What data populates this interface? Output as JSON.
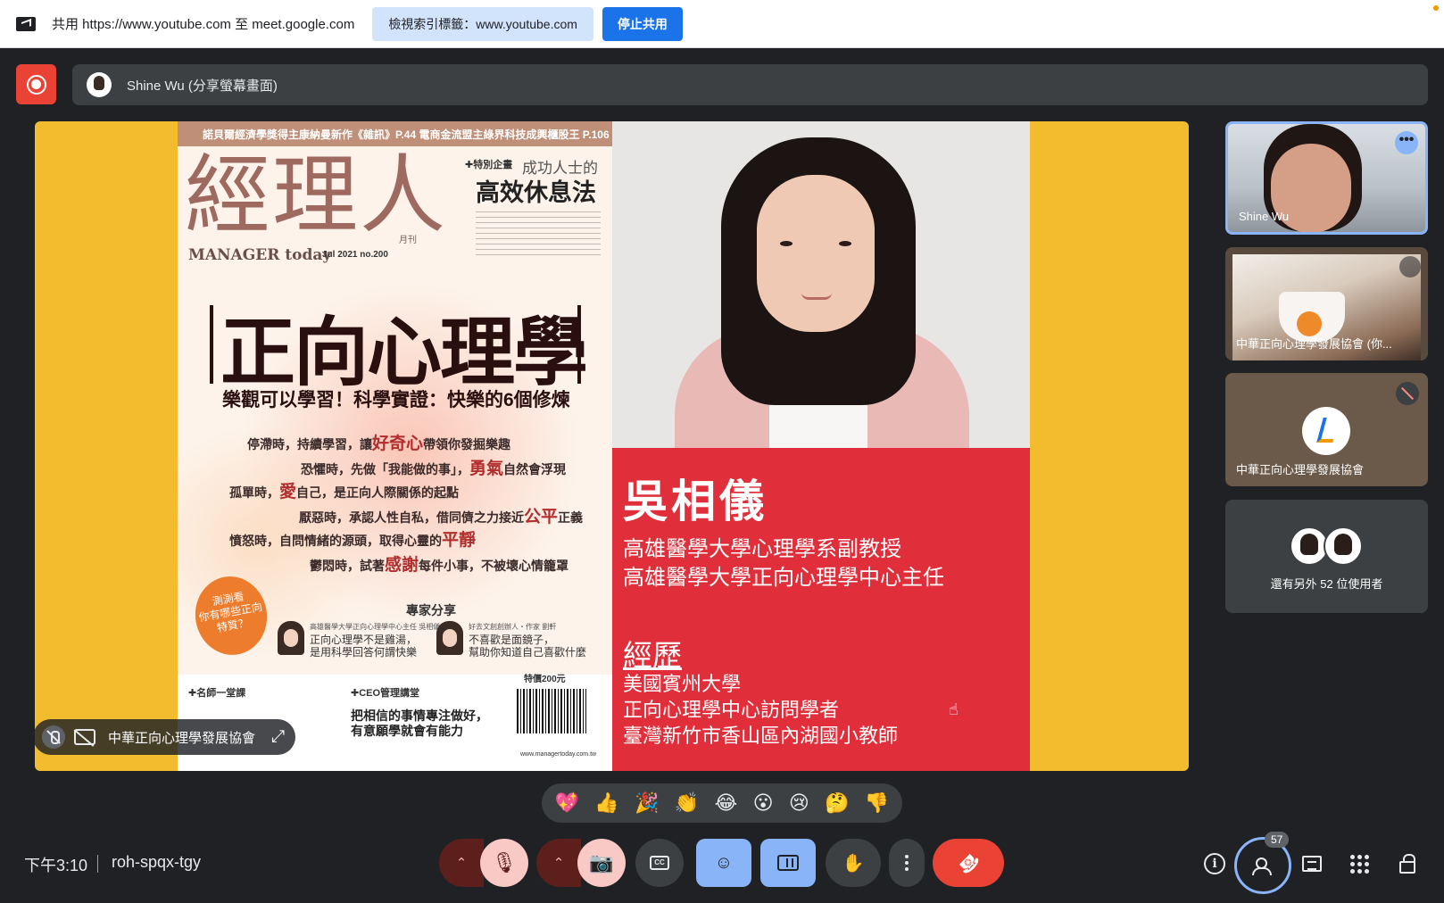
{
  "share_bar": {
    "sharing_text": "共用 https://www.youtube.com 至 meet.google.com",
    "view_tab_button": "檢視索引標籤：www.youtube.com",
    "stop_sharing_button": "停止共用"
  },
  "presenter_bar": {
    "name": "Shine Wu (分享螢幕畫面)"
  },
  "slide": {
    "magazine": {
      "top_strip": "諾貝爾經濟學獎得主康納曼新作《雜訊》P.44  電商金流盟主綠界科技成興櫃股王 P.106",
      "title": "經理人",
      "month": "月刊",
      "brand": "MANAGER today",
      "issue": "Jul 2021  no.200",
      "special_tag": "✚特別企畫",
      "special_sub": "成功人士的",
      "special_main": "高效休息法",
      "headline": "正向心理學",
      "subheadline": "樂觀可以學習！科學實證：快樂的6個修煉",
      "lines": [
        {
          "pre": "停滯時，持續學習，讓",
          "hl": "好奇心",
          "post": "帶領你發掘樂趣"
        },
        {
          "pre": "恐懼時，先做「我能做的事」，",
          "hl": "勇氣",
          "post": "自然會浮現"
        },
        {
          "pre": "孤單時，",
          "hl": "愛",
          "post": "自己，是正向人際關係的起點"
        },
        {
          "pre": "厭惡時，承認人性自私，借同儕之力接近",
          "hl": "公平",
          "post": "正義"
        },
        {
          "pre": "憤怒時，自問情緒的源頭，取得心靈的",
          "hl": "平靜",
          "post": ""
        },
        {
          "pre": "鬱悶時，試著",
          "hl": "感謝",
          "post": "每件小事，不被壞心情籠罩"
        }
      ],
      "badge": "測測看\n你有哪些正向\n特質？",
      "experts_title": "專家分享",
      "expert1_role": "高雄醫學大學正向心理學中心主任 吳相儀",
      "expert1_quote": "正向心理學不是雞湯，\n是用科學回答何謂快樂",
      "expert2_role": "好去文創創辦人・作家 劉軒",
      "expert2_quote": "不喜歡是面鏡子，\n幫助你知道自己喜歡什麼",
      "bottom_left": "✚名師一堂課",
      "bottom_mid_tag": "✚CEO管理講堂",
      "bottom_mid_main": "把相信的事情專注做好，\n有意願學就會有能力",
      "price": "特價200元",
      "url": "www.managertoday.com.tw"
    },
    "card": {
      "name": "吳相儀",
      "titles": [
        "高雄醫學大學心理學系副教授",
        "高雄醫學大學正向心理學中心主任"
      ],
      "experience_heading": "經歷",
      "experience": [
        "美國賓州大學",
        "正向心理學中心訪問學者",
        "臺灣新竹市香山區內湖國小教師"
      ]
    }
  },
  "pinned_label": {
    "name": "中華正向心理學發展協會"
  },
  "tiles": [
    {
      "name": "Shine Wu"
    },
    {
      "name": "中華正向心理學發展協會 (你..."
    },
    {
      "name": "中華正向心理學發展協會"
    },
    {
      "name": "還有另外 52 位使用者"
    }
  ],
  "reactions": [
    "💖",
    "👍",
    "🎉",
    "👏",
    "😂",
    "😮",
    "😢",
    "🤔",
    "👎"
  ],
  "bottom_bar": {
    "time": "下午3:10",
    "meeting_code": "roh-spqx-tgy",
    "participants_count": "57"
  },
  "icons": {
    "mic": "🎙",
    "cam": "📷",
    "emoji": "☺",
    "hand": "✋",
    "end_call": "☎",
    "expand": "⤢",
    "cursor": "☝",
    "chevron_up": "⌃"
  },
  "colors": {
    "accent_blue": "#8ab4f8",
    "end_call_red": "#ea4335",
    "slide_yellow": "#f3bc2f",
    "card_red": "#e02f3b"
  }
}
